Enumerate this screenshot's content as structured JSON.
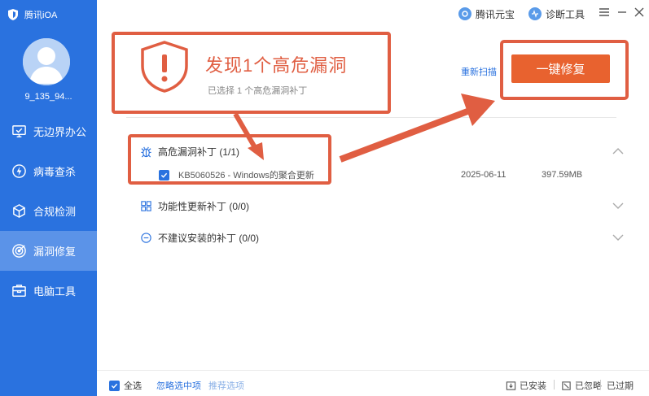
{
  "app": {
    "brand": "腾讯iOA",
    "username": "9_135_94..."
  },
  "sidebar": {
    "items": [
      {
        "label": "无边界办公",
        "icon": "monitor-check-icon",
        "active": false
      },
      {
        "label": "病毒查杀",
        "icon": "lightning-shield-icon",
        "active": false
      },
      {
        "label": "合规检测",
        "icon": "cube-icon",
        "active": false
      },
      {
        "label": "漏洞修复",
        "icon": "target-icon",
        "active": true
      },
      {
        "label": "电脑工具",
        "icon": "toolbox-icon",
        "active": false
      }
    ]
  },
  "topbar": {
    "tencent_yuanbao": "腾讯元宝",
    "diagnose_tool": "诊断工具"
  },
  "header": {
    "title": "发现1个高危漏洞",
    "subtitle": "已选择 1 个高危漏洞补丁",
    "rescan": "重新扫描",
    "fix_button": "一键修复"
  },
  "groups": [
    {
      "label": "高危漏洞补丁 (1/1)",
      "icon": "bug-icon",
      "expanded": true,
      "patches": [
        {
          "name": "KB5060526 - Windows的聚合更新",
          "date": "2025-06-11",
          "size": "397.59MB",
          "checked": true
        }
      ]
    },
    {
      "label": "功能性更新补丁 (0/0)",
      "icon": "grid-icon",
      "expanded": false
    },
    {
      "label": "不建议安装的补丁 (0/0)",
      "icon": "minus-circle-icon",
      "expanded": false
    }
  ],
  "footer": {
    "select_all": "全选",
    "ignore_selected": "忽略选中项",
    "recommended": "推荐选项",
    "installed": "已安装",
    "ignored": "已忽略",
    "expired": "已过期"
  },
  "colors": {
    "sidebar": "#2a72df",
    "accent": "#e05e42",
    "fix_button": "#e8622f"
  }
}
